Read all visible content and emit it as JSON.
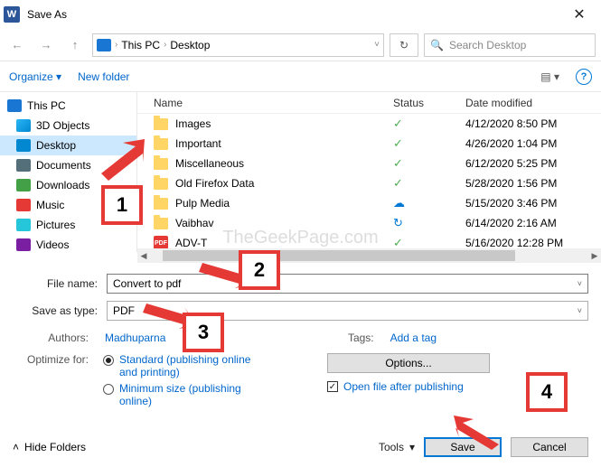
{
  "title": "Save As",
  "breadcrumb": {
    "root": "This PC",
    "folder": "Desktop"
  },
  "search_placeholder": "Search Desktop",
  "toolbar": {
    "organize": "Organize",
    "new_folder": "New folder"
  },
  "sidebar": [
    {
      "label": "This PC",
      "icon": "ic-pc",
      "root": true
    },
    {
      "label": "3D Objects",
      "icon": "ic-3d"
    },
    {
      "label": "Desktop",
      "icon": "ic-desk",
      "selected": true
    },
    {
      "label": "Documents",
      "icon": "ic-doc"
    },
    {
      "label": "Downloads",
      "icon": "ic-dl"
    },
    {
      "label": "Music",
      "icon": "ic-mus"
    },
    {
      "label": "Pictures",
      "icon": "ic-pic"
    },
    {
      "label": "Videos",
      "icon": "ic-vid"
    }
  ],
  "columns": {
    "name": "Name",
    "status": "Status",
    "date": "Date modified"
  },
  "files": [
    {
      "name": "Images",
      "type": "folder",
      "status": "check",
      "date": "4/12/2020 8:50 PM"
    },
    {
      "name": "Important",
      "type": "folder",
      "status": "check",
      "date": "4/26/2020 1:04 PM"
    },
    {
      "name": "Miscellaneous",
      "type": "folder",
      "status": "check",
      "date": "6/12/2020 5:25 PM"
    },
    {
      "name": "Old Firefox Data",
      "type": "folder",
      "status": "check",
      "date": "5/28/2020 1:56 PM"
    },
    {
      "name": "Pulp Media",
      "type": "folder",
      "status": "cloud",
      "date": "5/15/2020 3:46 PM"
    },
    {
      "name": "Vaibhav",
      "type": "folder",
      "status": "sync",
      "date": "6/14/2020 2:16 AM"
    },
    {
      "name": "ADV-T",
      "type": "pdf",
      "status": "check",
      "date": "5/16/2020 12:28 PM"
    }
  ],
  "file_name_label": "File name:",
  "file_name_value": "Convert to pdf",
  "save_type_label": "Save as type:",
  "save_type_value": "PDF",
  "authors_label": "Authors:",
  "authors_value": "Madhuparna",
  "tags_label": "Tags:",
  "tags_value": "Add a tag",
  "optimize_label": "Optimize for:",
  "optimize_standard": "Standard (publishing online and printing)",
  "optimize_min": "Minimum size (publishing online)",
  "options_btn": "Options...",
  "open_after": "Open file after publishing",
  "hide_folders": "Hide Folders",
  "tools": "Tools",
  "save": "Save",
  "cancel": "Cancel",
  "watermark": "TheGeekPage.com",
  "annotations": {
    "a1": "1",
    "a2": "2",
    "a3": "3",
    "a4": "4"
  }
}
